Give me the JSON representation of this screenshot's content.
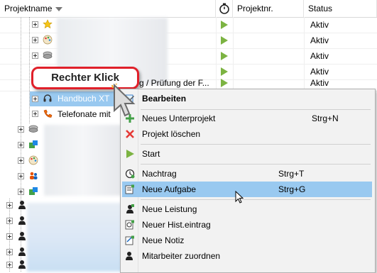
{
  "header": {
    "col_name": "Projektname",
    "col_timer_icon": "stopwatch-icon",
    "col_number": "Projektnr.",
    "col_status": "Status"
  },
  "rows": [
    {
      "name": "",
      "status": "Aktiv",
      "icon": "star-icon"
    },
    {
      "name": "",
      "status": "Aktiv",
      "icon": "palette-icon"
    },
    {
      "name": "",
      "status": "Aktiv",
      "icon": "stack-icon"
    },
    {
      "name": "",
      "status": "Aktiv",
      "icon": ""
    },
    {
      "name": "g / Prüfung der F...",
      "status": "Aktiv",
      "icon": ""
    },
    {
      "name": "Handbuch XT",
      "status": "",
      "icon": "headset-icon"
    },
    {
      "name": "Telefonate mit",
      "status": "",
      "icon": "phone-icon"
    }
  ],
  "callout": {
    "text": "Rechter Klick"
  },
  "context_menu": {
    "items": [
      {
        "label": "Bearbeiten",
        "shortcut": "",
        "icon": "edit-icon"
      },
      {
        "label": "Neues Unterprojekt",
        "shortcut": "Strg+N",
        "icon": "plus-icon"
      },
      {
        "label": "Projekt löschen",
        "shortcut": "",
        "icon": "delete-x-icon"
      },
      {
        "label": "Start",
        "shortcut": "",
        "icon": "play-icon"
      },
      {
        "label": "Nachtrag",
        "shortcut": "Strg+T",
        "icon": "clock-icon"
      },
      {
        "label": "Neue Aufgabe",
        "shortcut": "Strg+G",
        "icon": "task-icon"
      },
      {
        "label": "Neue Leistung",
        "shortcut": "",
        "icon": "service-icon"
      },
      {
        "label": "Neuer Hist.eintrag",
        "shortcut": "",
        "icon": "history-icon"
      },
      {
        "label": "Neue Notiz",
        "shortcut": "",
        "icon": "note-icon"
      },
      {
        "label": "Mitarbeiter zuordnen",
        "shortcut": "",
        "icon": "assign-person-icon"
      }
    ]
  },
  "colors": {
    "selection": "#99c9f0",
    "play_green": "#7cb342",
    "callout_border": "#e0202a"
  }
}
